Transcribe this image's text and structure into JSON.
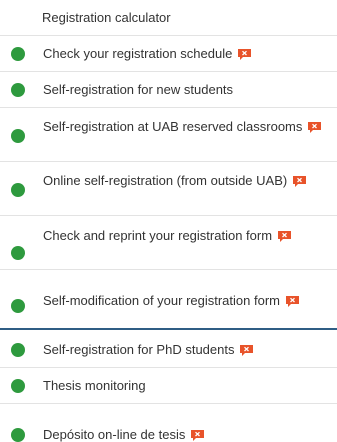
{
  "menu": {
    "items": [
      {
        "label": "Registration calculator",
        "bullet": false,
        "message_icon": false
      },
      {
        "label": "Check your registration schedule",
        "bullet": true,
        "message_icon": true
      },
      {
        "label": "Self-registration for new students",
        "bullet": true,
        "message_icon": false
      },
      {
        "label": "Self-registration at UAB reserved classrooms",
        "bullet": true,
        "message_icon": true
      },
      {
        "label": "Online self-registration (from outside UAB)",
        "bullet": true,
        "message_icon": true
      },
      {
        "label": "Check and reprint your registration form",
        "bullet": true,
        "message_icon": true
      },
      {
        "label": "Self-modification of your registration form",
        "bullet": true,
        "message_icon": true
      },
      {
        "label": "Self-registration for PhD students",
        "bullet": true,
        "message_icon": true
      },
      {
        "label": "Thesis monitoring",
        "bullet": true,
        "message_icon": false
      },
      {
        "label": "Depósito on-line de tesis",
        "bullet": true,
        "message_icon": true
      }
    ]
  },
  "icons": {
    "bullet": "green-circle-icon",
    "message": "message-alert-icon"
  },
  "colors": {
    "bullet": "#2e9a3e",
    "message_icon": "#e8532a",
    "separator": "#e3e3e3",
    "active_separator": "#2f5d84",
    "text": "#333333"
  }
}
